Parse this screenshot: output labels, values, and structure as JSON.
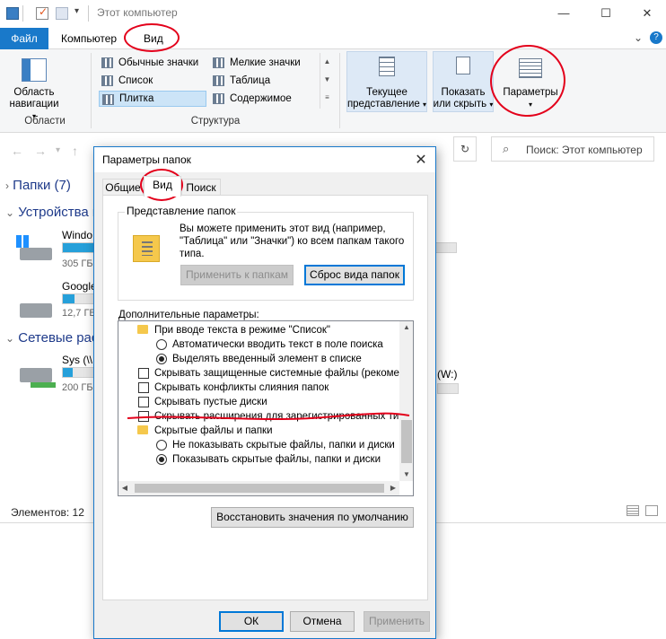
{
  "window": {
    "title": "Этот компьютер",
    "controls": {
      "minimize": "—",
      "maximize": "☐",
      "close": "✕"
    }
  },
  "menu": {
    "file": "Файл",
    "computer": "Компьютер",
    "view": "Вид",
    "expand": "⌄",
    "help": "?"
  },
  "ribbon": {
    "nav_pane_line1": "Область",
    "nav_pane_line2": "навигации",
    "areas_group": "Области",
    "layout_options": [
      "Обычные значки",
      "Мелкие значки",
      "Список",
      "Таблица",
      "Плитка",
      "Содержимое"
    ],
    "structure_group": "Структура",
    "current_view_line1": "Текущее",
    "current_view_line2": "представление",
    "show_hide_line1": "Показать",
    "show_hide_line2": "или скрыть",
    "parameters": "Параметры"
  },
  "address": {
    "search_placeholder": "Поиск: Этот компьютер"
  },
  "content": {
    "folders_header": "Папки (7)",
    "devices_header": "Устройства и",
    "drives": [
      {
        "name": "Windo",
        "size": "305 ГБ",
        "used": 0.55
      },
      {
        "name": "Google",
        "size": "12,7 ГБ",
        "used": 0.35
      },
      {
        "name": "Sys (\\\\",
        "size": "200 ГБ",
        "used": 0.3
      }
    ],
    "network_header": "Сетевые рас",
    "right_drive_label": "(W:)",
    "status_items": "Элементов: 12"
  },
  "dialog": {
    "title": "Параметры папок",
    "close": "✕",
    "tabs": [
      "Общие",
      "Вид",
      "Поиск"
    ],
    "folder_view_legend": "Представление папок",
    "folder_view_desc": "Вы можете применить этот вид (например, \"Таблица\" или \"Значки\") ко всем папкам такого типа.",
    "apply_to_folders": "Применить к папкам",
    "reset_folders": "Сброс вида папок",
    "advanced_label": "Дополнительные параметры:",
    "advanced_items": [
      {
        "type": "folder",
        "label": "При вводе текста в режиме \"Список\""
      },
      {
        "type": "radio",
        "checked": false,
        "label": "Автоматически вводить текст в поле поиска"
      },
      {
        "type": "radio",
        "checked": true,
        "label": "Выделять введенный элемент в списке"
      },
      {
        "type": "checkbox",
        "checked": false,
        "label": "Скрывать защищенные системные файлы (рекомен"
      },
      {
        "type": "checkbox",
        "checked": false,
        "label": "Скрывать конфликты слияния папок"
      },
      {
        "type": "checkbox",
        "checked": false,
        "label": "Скрывать пустые диски"
      },
      {
        "type": "checkbox",
        "checked": false,
        "label": "Скрывать расширения для зарегистрированных типо"
      },
      {
        "type": "folder",
        "label": "Скрытые файлы и папки"
      },
      {
        "type": "radio",
        "checked": false,
        "label": "Не показывать скрытые файлы, папки и диски"
      },
      {
        "type": "radio",
        "checked": true,
        "label": "Показывать скрытые файлы, папки и диски"
      }
    ],
    "restore_defaults": "Восстановить значения по умолчанию",
    "ok": "ОК",
    "cancel": "Отмена",
    "apply": "Применить"
  },
  "colors": {
    "accent": "#1979ca",
    "annotation": "#e3001b"
  }
}
